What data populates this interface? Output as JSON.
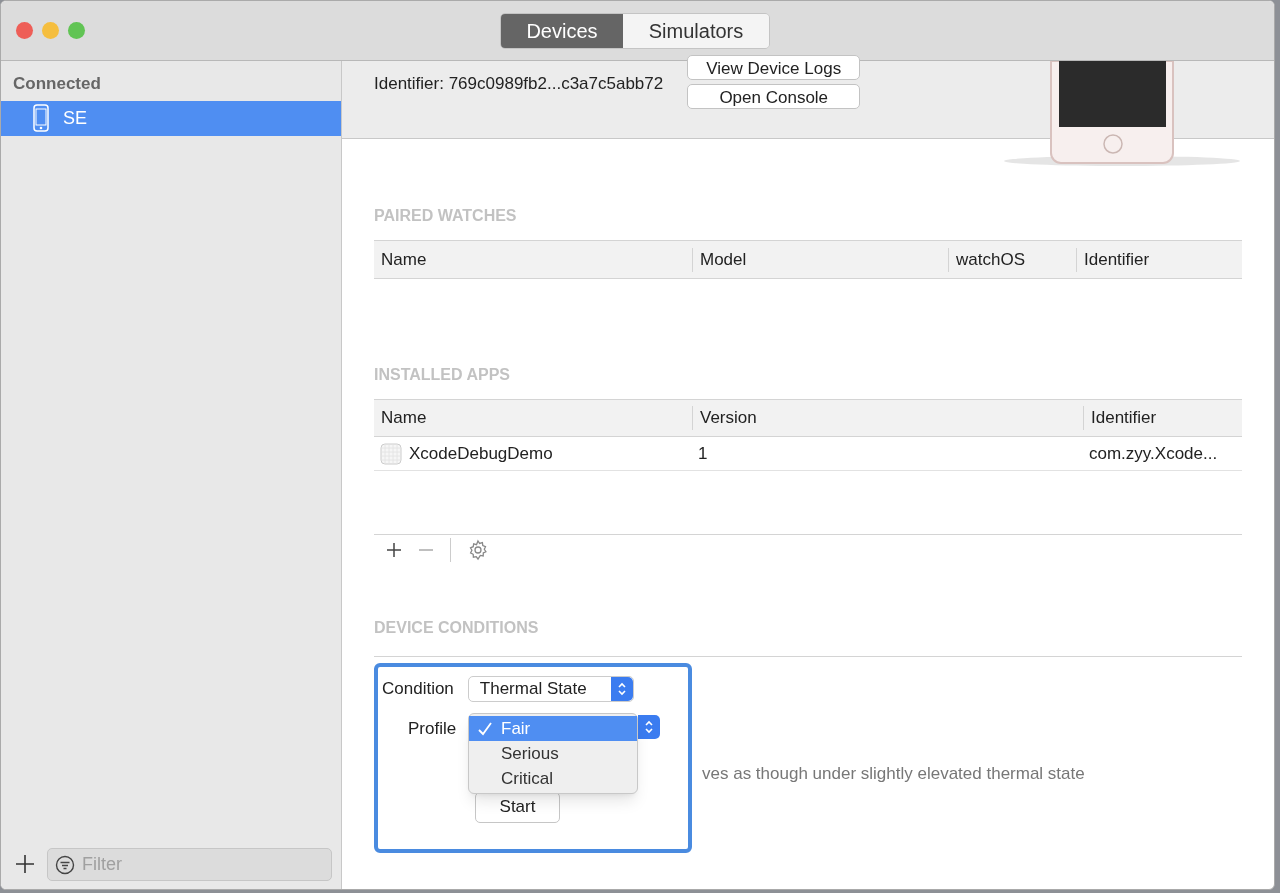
{
  "window": {
    "tabs": [
      {
        "label": "Devices",
        "selected": true
      },
      {
        "label": "Simulators",
        "selected": false
      }
    ]
  },
  "sidebar": {
    "section": "Connected",
    "items": [
      {
        "label": "SE",
        "selected": true
      }
    ],
    "filter": {
      "placeholder": "Filter"
    }
  },
  "device": {
    "identifier": "Identifier: 769c0989fb2...c3a7c5abb72",
    "buttons": [
      "View Device Logs",
      "Open Console"
    ]
  },
  "paired_watches": {
    "title": "PAIRED WATCHES",
    "columns": [
      "Name",
      "Model",
      "watchOS",
      "Identifier"
    ]
  },
  "installed_apps": {
    "title": "INSTALLED APPS",
    "columns": [
      "Name",
      "Version",
      "Identifier"
    ],
    "rows": [
      {
        "name": "XcodeDebugDemo",
        "version": "1",
        "identifier": "com.zyy.Xcode..."
      }
    ]
  },
  "device_conditions": {
    "title": "DEVICE CONDITIONS",
    "condition_label": "Condition",
    "condition_value": "Thermal State",
    "profile_label": "Profile",
    "profile_options": [
      {
        "label": "Fair",
        "selected": true
      },
      {
        "label": "Serious",
        "selected": false
      },
      {
        "label": "Critical",
        "selected": false
      }
    ],
    "description": "ves as though under slightly elevated thermal state",
    "start": "Start"
  }
}
